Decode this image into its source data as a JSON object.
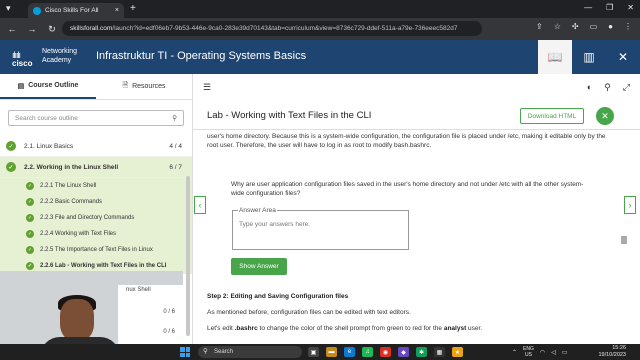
{
  "browser": {
    "tab_title": "Cisco Skills For All",
    "tab_close": "×",
    "new_tab": "+",
    "url_host": "skillsforall.com",
    "url_path": "/launch?id=edf06eb7-9b53-446e-9ca0-283e39d70143&tab=curriculum&view=8736c729-ddef-511a-a79e-736eeec582d7"
  },
  "app": {
    "logo_top": "Networking",
    "logo_bottom": "Academy",
    "logo_cisco": "cisco",
    "title": "Infrastruktur TI - Operating Systems Basics",
    "close_glyph": "✕"
  },
  "sidebar": {
    "tabs": [
      {
        "label": "Course Outline"
      },
      {
        "label": "Resources"
      }
    ],
    "search_placeholder": "Search course outline",
    "modules": [
      {
        "label": "2.1. Linux Basics",
        "count": "4 / 4"
      },
      {
        "label": "2.2. Working in the Linux Shell",
        "count": "6 / 7"
      }
    ],
    "subitems": [
      {
        "label": "2.2.1 The Linux Shell"
      },
      {
        "label": "2.2.2 Basic Commands"
      },
      {
        "label": "2.2.3 File and Directory Commands"
      },
      {
        "label": "2.2.4 Working with Text Files"
      },
      {
        "label": "2.2.5 The Importance of Text Files in Linux"
      },
      {
        "label": "2.2.6 Lab - Working with Text Files in the CLI"
      }
    ],
    "hidden_items": [
      {
        "label": "nux Shell"
      },
      {
        "label": "0 / 6"
      },
      {
        "label": "0 / 6"
      }
    ]
  },
  "lab": {
    "title": "Lab - Working with Text Files in the CLI",
    "download_label": "Download HTML",
    "intro_line": "user's home directory. Because this is a system-wide configuration, the configuration file is placed under /etc, making it editable only by the root user. Therefore, the user will have to log in as root to modify bash.bashrc.",
    "question": "Why are user application configuration files saved in the user's home directory and not under /etc with all the other system-wide configuration files?",
    "answer_legend": "Answer Area",
    "answer_placeholder": "Type your answers here.",
    "show_answer": "Show Answer",
    "step_title": "Step 2: Editing and Saving Configuration files",
    "para1": "As mentioned before, configuration files can be edited with text editors.",
    "para2_a": "Let's edit ",
    "para2_b": ".bashrc",
    "para2_c": " to change the color of the shell prompt from green to red for the ",
    "para2_d": "analyst",
    "para2_e": " user."
  },
  "taskbar": {
    "search_label": "Search",
    "lang_line1": "ENG",
    "lang_line2": "US",
    "time": "15:26",
    "date": "19/10/2023"
  },
  "colors": {
    "brand": "#1e4471",
    "accent": "#49a54a"
  }
}
